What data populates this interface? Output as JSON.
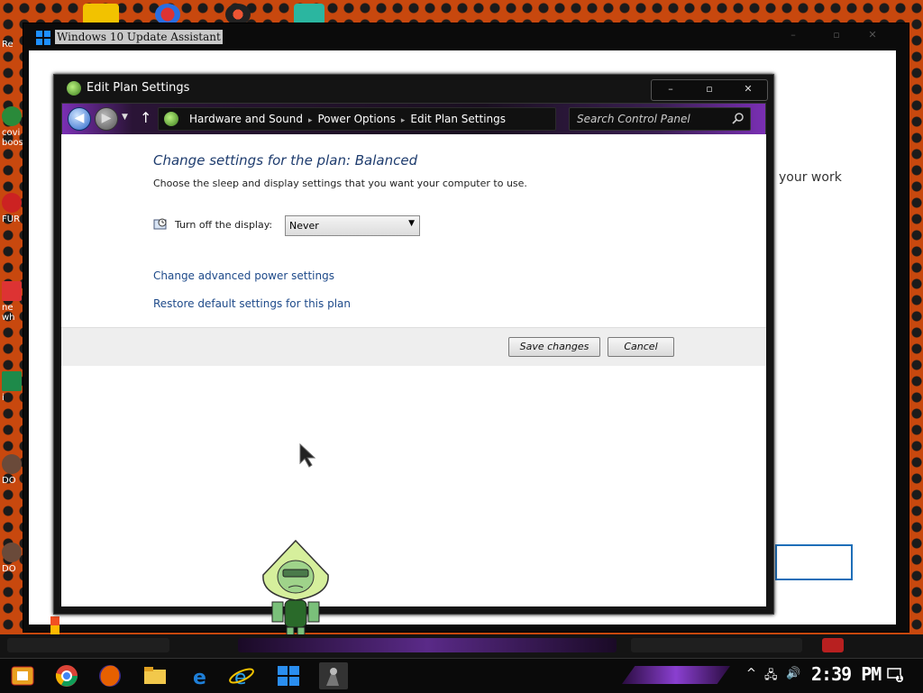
{
  "desktop": {
    "icon_labels": [
      "Re",
      "covi\nboos",
      "FUR",
      "ne\nwh",
      "i",
      "DO",
      "DO"
    ]
  },
  "background_window": {
    "title": "Windows 10 Update Assistant",
    "controls": [
      "–",
      "▫",
      "✕"
    ],
    "partial_text": "your work"
  },
  "window": {
    "title": "Edit Plan Settings",
    "controls": [
      "–",
      "▫",
      "✕"
    ]
  },
  "nav": {
    "back_glyph": "◀",
    "forward_glyph": "▶",
    "up_glyph": "↑",
    "dropdown_glyph": "▼",
    "breadcrumb": [
      "Hardware and Sound",
      "Power Options",
      "Edit Plan Settings"
    ],
    "breadcrumb_separator": "▸",
    "search_placeholder": "Search Control Panel"
  },
  "content": {
    "heading": "Change settings for the plan: Balanced",
    "subheading": "Choose the sleep and display settings that you want your computer to use.",
    "display_label": "Turn off the display:",
    "display_value": "Never",
    "display_arrow": "▼",
    "link_advanced": "Change advanced power settings",
    "link_restore": "Restore default settings for this plan",
    "save_label": "Save changes",
    "cancel_label": "Cancel"
  },
  "taskbar": {
    "apps": [
      "start-icon",
      "chrome-icon",
      "firefox-icon",
      "file-explorer-icon",
      "edge-icon",
      "internet-explorer-icon",
      "windows-icon",
      "character-icon"
    ],
    "tray_chevron": "^",
    "tray_network": "🖧",
    "tray_volume": "🔊",
    "time": "2:39 PM",
    "notification_count": "1"
  },
  "colors": {
    "heading": "#1e3c6e",
    "link": "#1e4a8a",
    "accent_purple": "#7a2fb4",
    "desktop_bg": "#c8480e"
  }
}
